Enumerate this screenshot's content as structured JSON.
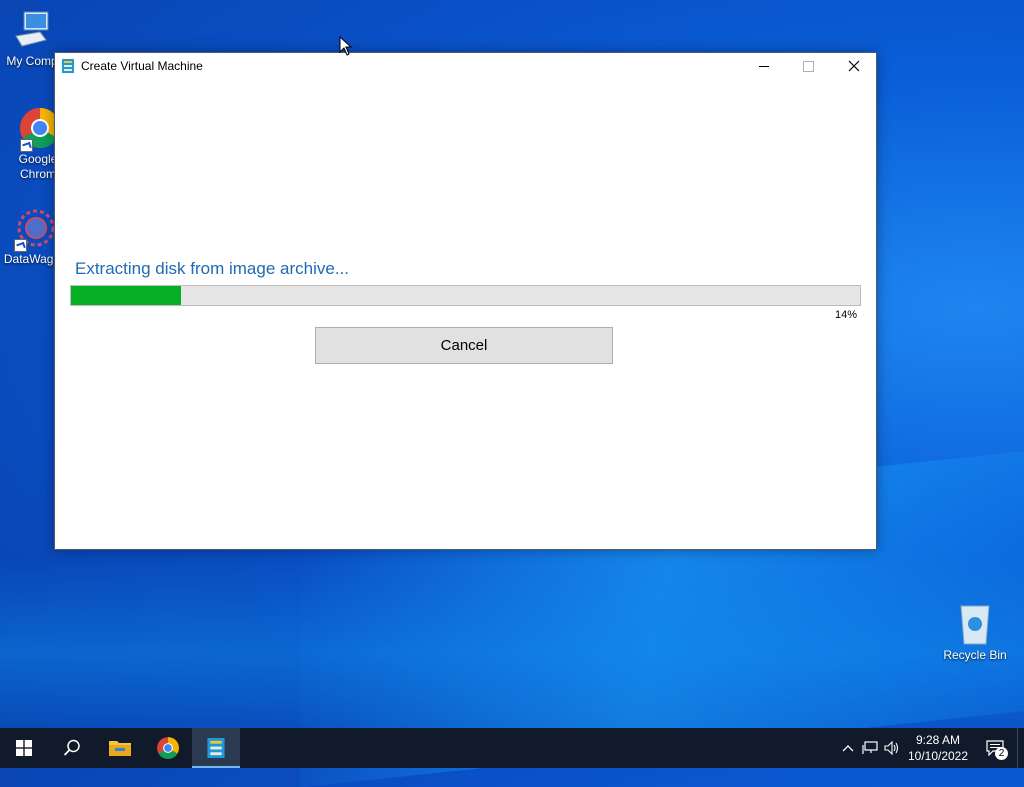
{
  "desktop": {
    "icons": [
      {
        "label": "My Comp",
        "icon": "computer-icon"
      },
      {
        "label": "Google Chrom",
        "icon": "chrome-icon"
      },
      {
        "label": "DataWago",
        "icon": "datawago-icon"
      },
      {
        "label": "Recycle Bin",
        "icon": "recycle-bin-icon"
      }
    ]
  },
  "window": {
    "title": "Create Virtual Machine",
    "icon": "vm-app-icon",
    "controls": {
      "minimize": "minimize-icon",
      "maximize": "maximize-icon",
      "close": "close-icon"
    },
    "status_text": "Extracting disk from image archive...",
    "progress": {
      "value": 0.14,
      "label": "14%",
      "color": "#06b025"
    },
    "cancel_label": "Cancel"
  },
  "taskbar": {
    "buttons": [
      "start-icon",
      "search-icon",
      "file-explorer-icon",
      "chrome-icon",
      "vm-app-icon"
    ],
    "active_button": "vm-app-icon",
    "tray": {
      "time": "9:28 AM",
      "date": "10/10/2022",
      "notifications": "2"
    }
  },
  "colors": {
    "accent_text": "#1f6ab0",
    "taskbar_bg": "#101a2a",
    "progress_fill": "#06b025"
  }
}
